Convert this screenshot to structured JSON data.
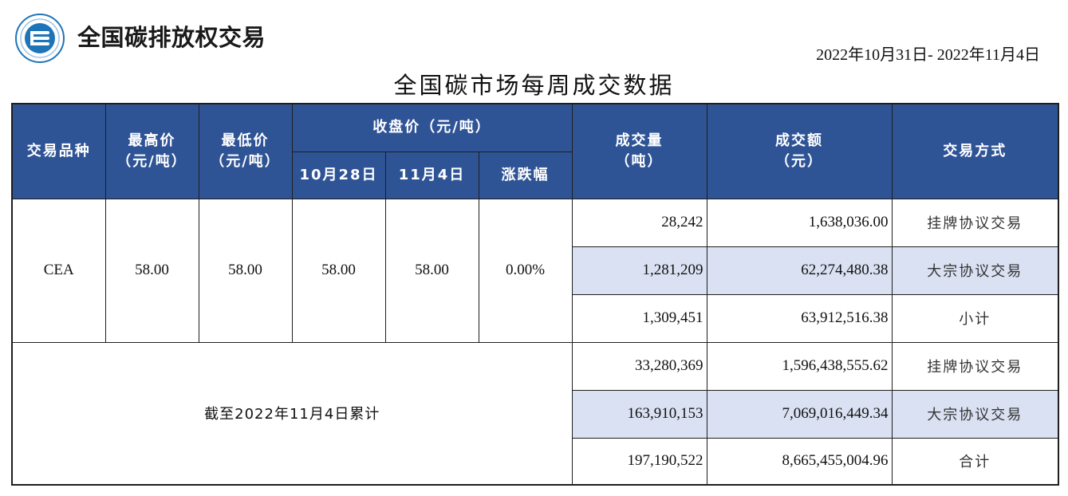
{
  "header": {
    "brand": "全国碳排放权交易",
    "date_range": "2022年10月31日- 2022年11月4日",
    "title": "全国碳市场每周成交数据",
    "logo_color": "#1f74b8"
  },
  "columns": {
    "variety": "交易品种",
    "high": [
      "最高价",
      "（元/吨）"
    ],
    "low": [
      "最低价",
      "（元/吨）"
    ],
    "close_group": "收盘价（元/吨）",
    "close_prev": "10月28日",
    "close_curr": "11月4日",
    "change": "涨跌幅",
    "volume": [
      "成交量",
      "（吨）"
    ],
    "amount": [
      "成交额",
      "（元）"
    ],
    "method": "交易方式"
  },
  "weekly": {
    "variety": "CEA",
    "high": "58.00",
    "low": "58.00",
    "close_prev": "58.00",
    "close_curr": "58.00",
    "change": "0.00%",
    "rows": [
      {
        "volume": "28,242",
        "amount": "1,638,036.00",
        "method": "挂牌协议交易"
      },
      {
        "volume": "1,281,209",
        "amount": "62,274,480.38",
        "method": "大宗协议交易"
      },
      {
        "volume": "1,309,451",
        "amount": "63,912,516.38",
        "method": "小计"
      }
    ]
  },
  "cumulative": {
    "label": "截至2022年11月4日累计",
    "rows": [
      {
        "volume": "33,280,369",
        "amount": "1,596,438,555.62",
        "method": "挂牌协议交易"
      },
      {
        "volume": "163,910,153",
        "amount": "7,069,016,449.34",
        "method": "大宗协议交易"
      },
      {
        "volume": "197,190,522",
        "amount": "8,665,455,004.96",
        "method": "合计"
      }
    ]
  },
  "colors": {
    "header_bg": "#2f5496",
    "shaded_row": "#d9e1f2"
  }
}
